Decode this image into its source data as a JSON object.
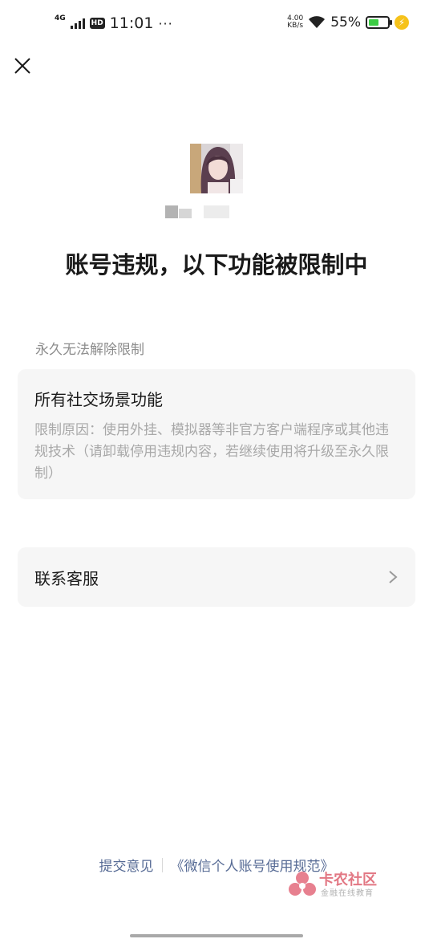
{
  "status_bar": {
    "network": "4G",
    "hd": "HD",
    "time": "11:01",
    "more": "···",
    "speed_value": "4.00",
    "speed_unit": "KB/s",
    "battery_percent": "55%",
    "battery_level": 0.55
  },
  "page": {
    "title": "账号违规，以下功能被限制中",
    "section_label": "永久无法解除限制"
  },
  "restriction_card": {
    "title": "所有社交场景功能",
    "description": "限制原因：使用外挂、模拟器等非官方客户端程序或其他违规技术（请卸载停用违规内容，若继续使用将升级至永久限制）"
  },
  "contact_card": {
    "label": "联系客服"
  },
  "footer": {
    "feedback_link": "提交意见",
    "rules_link": "《微信个人账号使用规范》"
  },
  "watermark": {
    "brand": "卡农社区",
    "subtitle": "金融在线教育"
  },
  "colors": {
    "link": "#576b95",
    "card_bg": "#f6f6f6",
    "muted_text": "#a8a8a8",
    "battery_fill": "#3ccc44",
    "charge_badge": "#f6c21a"
  },
  "icons": [
    "close-icon",
    "chevron-right-icon",
    "wifi-icon",
    "signal-icon",
    "battery-icon",
    "charging-icon"
  ]
}
